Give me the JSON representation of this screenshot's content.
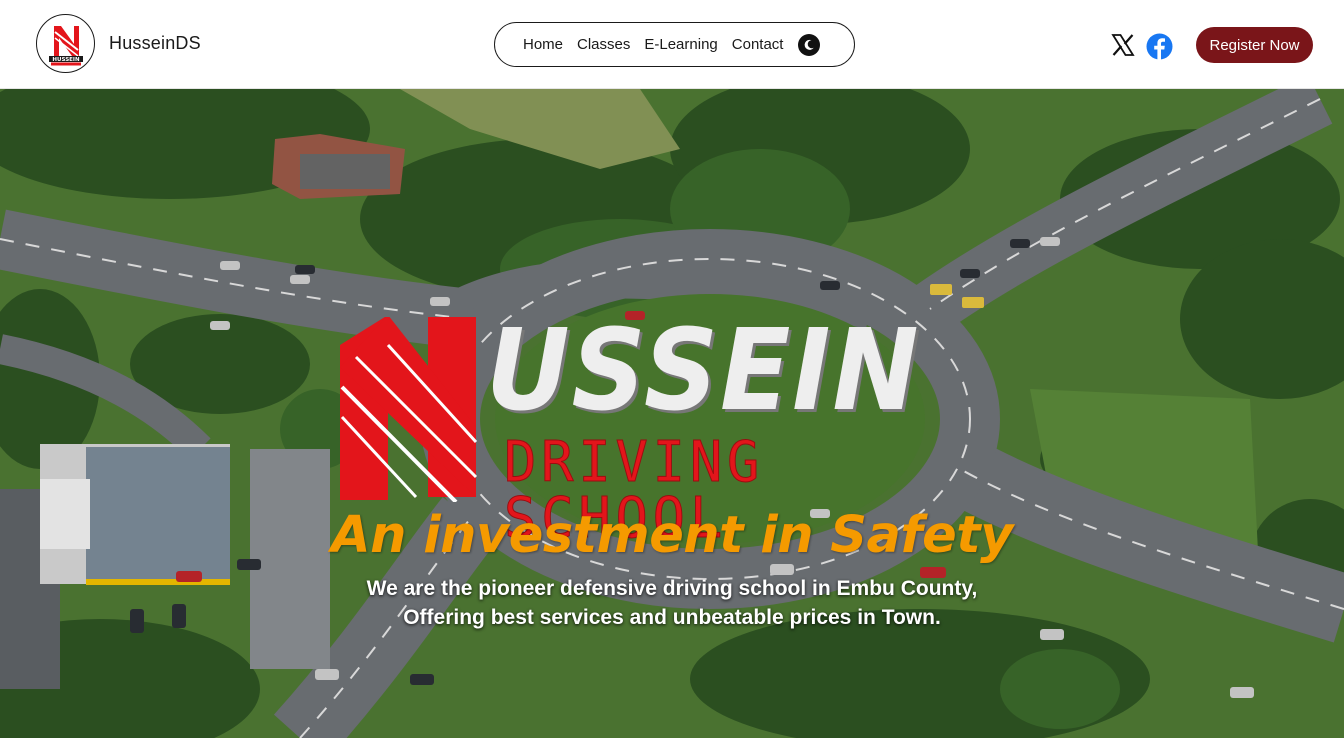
{
  "brand": {
    "name": "HusseinDS",
    "logo_text": "HUSSEIN",
    "logo_subtext": "DRIVING SCHOOL"
  },
  "nav": {
    "items": [
      {
        "label": "Home"
      },
      {
        "label": "Classes"
      },
      {
        "label": "E-Learning"
      },
      {
        "label": "Contact"
      }
    ],
    "theme_toggle_icon": "moon-icon"
  },
  "social": {
    "x_icon": "x-twitter-icon",
    "facebook_icon": "facebook-icon"
  },
  "register": {
    "label": "Register Now"
  },
  "hero": {
    "logo_word": "USSEIN",
    "logo_sub": "DRIVING SCHOOL",
    "tagline": "An investment in Safety",
    "subtext_line1": "We are the pioneer defensive driving school in Embu County,",
    "subtext_line2": "Offering best services and unbeatable prices in Town."
  },
  "colors": {
    "brand_red": "#e3151b",
    "register_bg": "#7a1519",
    "tagline_orange": "#f59a00",
    "nav_border": "#1a1a1a"
  }
}
